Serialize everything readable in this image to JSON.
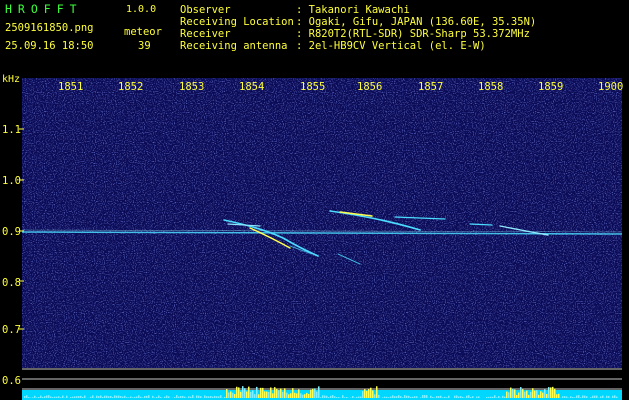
{
  "app": {
    "title": "HROFFT",
    "version": "1.0.0"
  },
  "capture": {
    "filename": "2509161850.png",
    "datetime": "25.09.16 18:50"
  },
  "meteor": {
    "label": "meteor",
    "count": "39"
  },
  "info": [
    {
      "label": "Observer",
      "value": ": Takanori Kawachi"
    },
    {
      "label": "Receiving Location",
      "value": ": Ogaki, Gifu, JAPAN (136.60E, 35.35N)"
    },
    {
      "label": "Receiver",
      "value": ": R820T2(RTL-SDR) SDR-Sharp 53.372MHz"
    },
    {
      "label": "Receiving antenna",
      "value": ": 2el-HB9CV Vertical (el. E-W)"
    }
  ],
  "spectrogram": {
    "unit_label": "kHz",
    "time_ticks": [
      "1851",
      "1852",
      "1853",
      "1854",
      "1855",
      "1856",
      "1857",
      "1858",
      "1859",
      "1900"
    ],
    "freq_ticks": [
      "1.1",
      "1.0",
      "0.9",
      "0.8",
      "0.7",
      "0.6"
    ],
    "colors": {
      "background": "#0a0a55",
      "noise": "#2d3cc8",
      "signal": "#4bdcff",
      "strong": "#ffff50",
      "axis": "#ffff3c"
    }
  }
}
